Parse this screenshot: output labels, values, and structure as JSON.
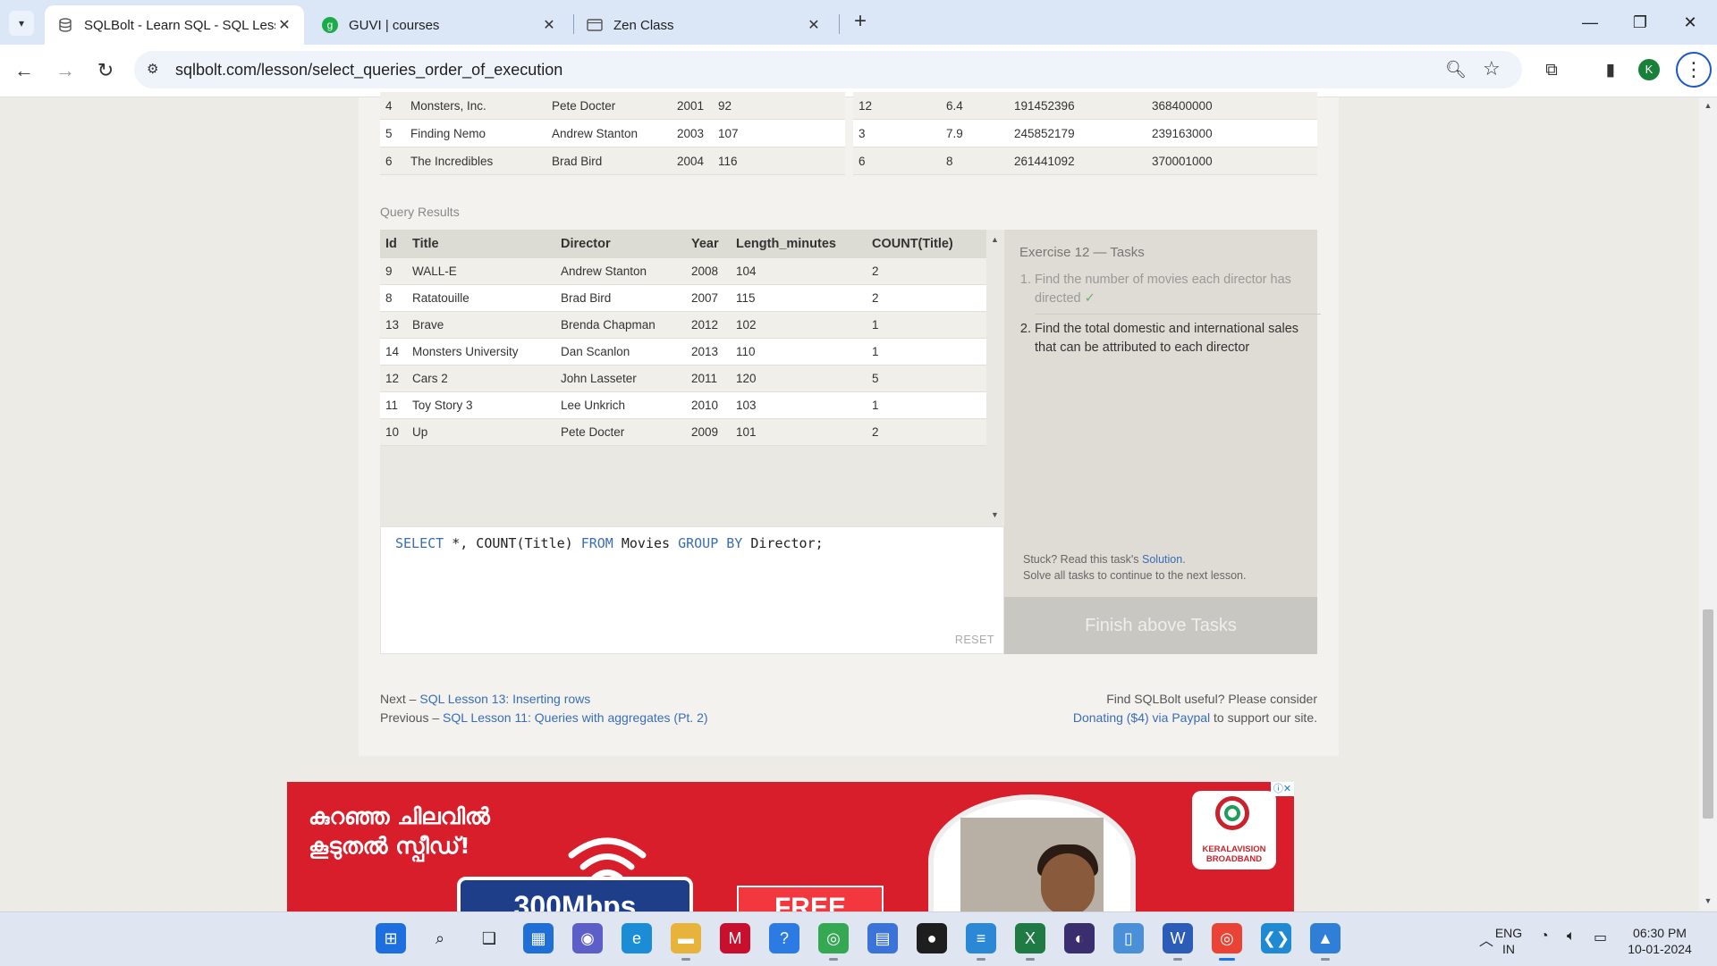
{
  "browser": {
    "tabs": [
      {
        "title": "SQLBolt - Learn SQL - SQL Less",
        "favicon": "database-icon",
        "active": true
      },
      {
        "title": "GUVI | courses",
        "favicon": "guvi-icon",
        "active": false
      },
      {
        "title": "Zen Class",
        "favicon": "page-icon",
        "active": false
      }
    ],
    "url": "sqlbolt.com/lesson/select_queries_order_of_execution",
    "profile_initial": "K"
  },
  "top_left_table": [
    [
      "4",
      "Monsters, Inc.",
      "Pete Docter",
      "2001",
      "92"
    ],
    [
      "5",
      "Finding Nemo",
      "Andrew Stanton",
      "2003",
      "107"
    ],
    [
      "6",
      "The Incredibles",
      "Brad Bird",
      "2004",
      "116"
    ]
  ],
  "top_right_table": [
    [
      "12",
      "6.4",
      "191452396",
      "368400000"
    ],
    [
      "3",
      "7.9",
      "245852179",
      "239163000"
    ],
    [
      "6",
      "8",
      "261441092",
      "370001000"
    ]
  ],
  "results": {
    "label": "Query Results",
    "columns": [
      "Id",
      "Title",
      "Director",
      "Year",
      "Length_minutes",
      "COUNT(Title)"
    ],
    "rows": [
      [
        "9",
        "WALL-E",
        "Andrew Stanton",
        "2008",
        "104",
        "2"
      ],
      [
        "8",
        "Ratatouille",
        "Brad Bird",
        "2007",
        "115",
        "2"
      ],
      [
        "13",
        "Brave",
        "Brenda Chapman",
        "2012",
        "102",
        "1"
      ],
      [
        "14",
        "Monsters University",
        "Dan Scanlon",
        "2013",
        "110",
        "1"
      ],
      [
        "12",
        "Cars 2",
        "John Lasseter",
        "2011",
        "120",
        "5"
      ],
      [
        "11",
        "Toy Story 3",
        "Lee Unkrich",
        "2010",
        "103",
        "1"
      ],
      [
        "10",
        "Up",
        "Pete Docter",
        "2009",
        "101",
        "2"
      ]
    ]
  },
  "editor": {
    "query_tokens": [
      {
        "t": "SELECT",
        "kw": true
      },
      {
        "t": " *, COUNT(Title) ",
        "kw": false
      },
      {
        "t": "FROM",
        "kw": true
      },
      {
        "t": " Movies ",
        "kw": false
      },
      {
        "t": "GROUP BY",
        "kw": true
      },
      {
        "t": " Director;",
        "kw": false
      }
    ],
    "reset_label": "RESET"
  },
  "tasks": {
    "title": "Exercise 12 — Tasks",
    "items": [
      {
        "text": "Find the number of movies each director has directed",
        "done": true
      },
      {
        "text": "Find the total domestic and international sales that can be attributed to each director",
        "done": false
      }
    ],
    "check_mark": "✓",
    "stuck_prefix": "Stuck? Read this task's ",
    "stuck_link": "Solution",
    "stuck_suffix": ".",
    "solve_note": "Solve all tasks to continue to the next lesson.",
    "finish_label": "Finish above Tasks"
  },
  "footer": {
    "next_prefix": "Next – ",
    "next_link": "SQL Lesson 13: Inserting rows",
    "prev_prefix": "Previous – ",
    "prev_link": "SQL Lesson 11: Queries with aggregates (Pt. 2)",
    "donate_line1": "Find SQLBolt useful? Please consider",
    "donate_link": "Donating ($4) via Paypal",
    "donate_suffix": " to support our site."
  },
  "ad": {
    "headline_line1": "കുറഞ്ഞ ചിലവിൽ",
    "headline_line2": "കൂടുതൽ സ്പീഡ്!",
    "speed": "300Mbps",
    "free": "FREE",
    "brand_line1": "KERALAVISION",
    "brand_line2": "BROADBAND",
    "brand_color": "#d81e2b"
  },
  "tray": {
    "lang": "ENG",
    "region": "IN",
    "time": "06:30 PM",
    "date": "10-01-2024"
  },
  "taskbar_icons": [
    "windows-start-icon",
    "search-icon",
    "task-view-icon",
    "widgets-icon",
    "teams-chat-icon",
    "edge-icon",
    "file-explorer-icon",
    "mcafee-icon",
    "help-icon",
    "chrome-icon",
    "store-icon",
    "github-icon",
    "notepad-icon",
    "excel-icon",
    "eclipse-icon",
    "files-icon",
    "word-icon",
    "chrome-profile-icon",
    "vscode-icon",
    "photos-icon"
  ]
}
